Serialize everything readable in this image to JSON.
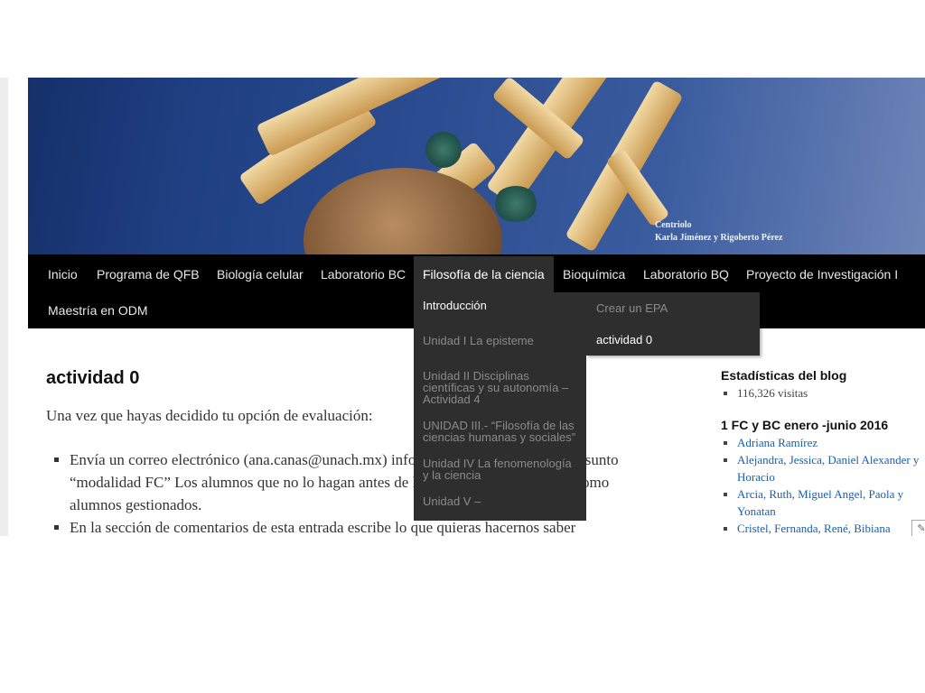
{
  "header": {
    "caption_title": "Centriolo",
    "caption_authors": "Karla Jiménez y Rigoberto Pérez"
  },
  "nav": {
    "items": [
      {
        "label": "Inicio"
      },
      {
        "label": "Programa de QFB"
      },
      {
        "label": "Biología celular"
      },
      {
        "label": "Laboratorio BC"
      },
      {
        "label": "Filosofía de la ciencia"
      },
      {
        "label": "Bioquímica"
      },
      {
        "label": "Laboratorio BQ"
      },
      {
        "label": "Proyecto de Investigación I"
      },
      {
        "label": "Maestría en ODM"
      }
    ],
    "dropdown": [
      "Introducción",
      "Unidad I La episteme",
      "Unidad II Disciplinas científicas y su autonomía – Actividad 4",
      "UNIDAD III.- “Filosofía de las ciencias humanas y sociales”",
      "Unidad IV La fenomenología y la ciencia",
      "Unidad V –"
    ],
    "subdropdown": [
      "Crear un EPA",
      "actividad 0"
    ]
  },
  "post": {
    "title": "actividad 0",
    "intro": "Una vez que hayas decidido tu opción de evaluación:",
    "bullet1": "Envía un correo electrónico (ana.canas@unach.mx) informando tu decisión con el asunto “modalidad FC” Los alumnos que no lo hagan antes de la fecha límite se tomarán como alumnos gestionados.",
    "bullet2": "En la sección de comentarios de esta entrada escribe lo que quieras hacernos saber"
  },
  "sidebar": {
    "stats_title": "Estadísticas del blog",
    "stats_value": "116,326 visitas",
    "group_title": "1 FC y BC enero -junio 2016",
    "links": [
      "Adriana Ramírez",
      "Alejandra, Jessica, Daniel Alexander y Horacio",
      "Arcia, Ruth, Miguel Angel, Paola y Yonatan",
      "Cristel, Fernanda, René, Bibiana"
    ]
  },
  "colors": {
    "nav_bg": "#000000",
    "dropdown_bg": "#2e2e2e",
    "link": "#1b5ea8"
  }
}
